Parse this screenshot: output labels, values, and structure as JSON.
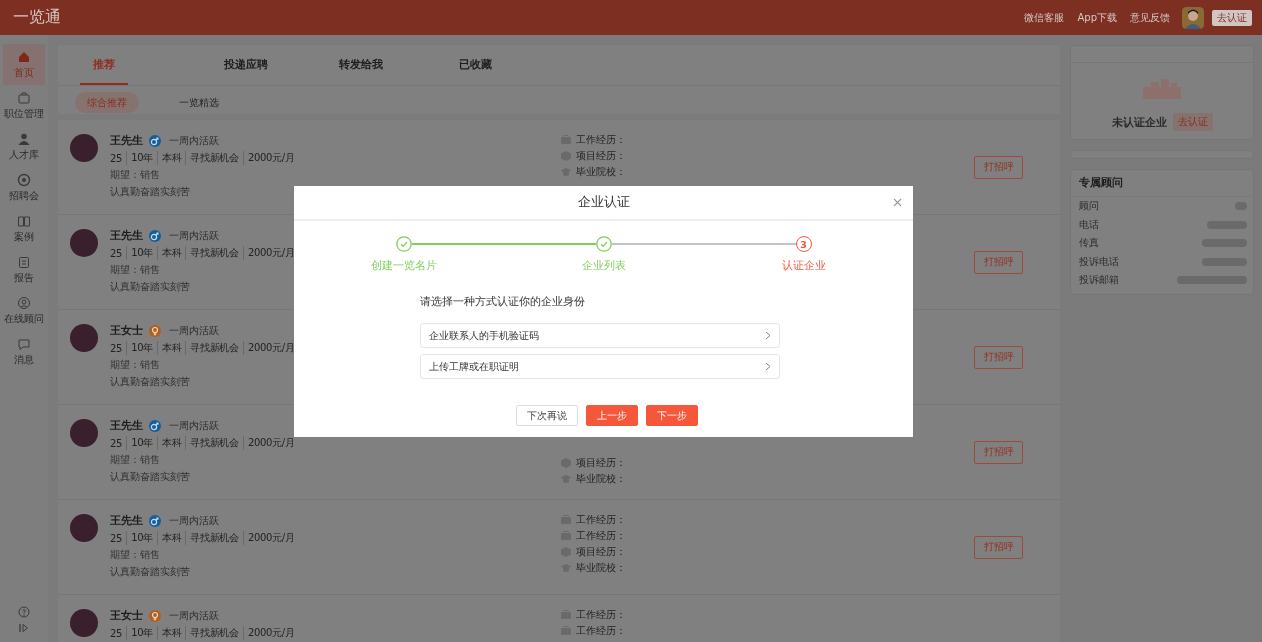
{
  "topbar": {
    "logo": "一览通",
    "links": [
      "微信客服",
      "App下载",
      "意见反馈"
    ],
    "verify_button": "去认证"
  },
  "sidebar": {
    "items": [
      {
        "label": "首页",
        "selected": true
      },
      {
        "label": "职位管理",
        "selected": false
      },
      {
        "label": "人才库",
        "selected": false
      },
      {
        "label": "招聘会",
        "selected": false
      },
      {
        "label": "案例",
        "selected": false
      },
      {
        "label": "报告",
        "selected": false
      },
      {
        "label": "在线顾问",
        "selected": false
      },
      {
        "label": "消息",
        "selected": false
      }
    ]
  },
  "tabs": [
    {
      "label": "推荐",
      "selected": true
    },
    {
      "label": "投递应聘",
      "selected": false
    },
    {
      "label": "转发给我",
      "selected": false
    },
    {
      "label": "已收藏",
      "selected": false
    }
  ],
  "subtabs": [
    {
      "label": "综合推荐",
      "selected": true
    },
    {
      "label": "一览精选",
      "selected": false
    }
  ],
  "candidates": [
    {
      "name": "王先生",
      "kind": "male",
      "activity": "一周内活跃",
      "stats": [
        "25",
        "10年",
        "本科",
        "寻找新机会",
        "2000元/月"
      ],
      "expect": "期望：销售",
      "motto": "认真勤奋踏实刻苦",
      "experience": [
        {
          "kind": "work",
          "label": "工作经历："
        },
        {
          "kind": "project",
          "label": "项目经历："
        },
        {
          "kind": "school",
          "label": "毕业院校："
        }
      ],
      "action": "打招呼"
    },
    {
      "name": "王先生",
      "kind": "male",
      "activity": "一周内活跃",
      "stats": [
        "25",
        "10年",
        "本科",
        "寻找新机会",
        "2000元/月"
      ],
      "expect": "期望：销售",
      "motto": "认真勤奋踏实刻苦",
      "action": "打招呼"
    },
    {
      "name": "王女士",
      "kind": "female",
      "activity": "一周内活跃",
      "stats": [
        "25",
        "10年",
        "本科",
        "寻找新机会",
        "2000元/月"
      ],
      "expect": "期望：销售",
      "motto": "认真勤奋踏实刻苦",
      "action": "打招呼"
    },
    {
      "name": "王先生",
      "kind": "male",
      "activity": "一周内活跃",
      "stats": [
        "25",
        "10年",
        "本科",
        "寻找新机会",
        "2000元/月"
      ],
      "expect": "期望：销售",
      "motto": "认真勤奋踏实刻苦",
      "experience": [
        {
          "kind": "project",
          "label": "项目经历："
        },
        {
          "kind": "school",
          "label": "毕业院校："
        }
      ],
      "action": "打招呼"
    },
    {
      "name": "王先生",
      "kind": "male",
      "activity": "一周内活跃",
      "stats": [
        "25",
        "10年",
        "本科",
        "寻找新机会",
        "2000元/月"
      ],
      "expect": "期望：销售",
      "motto": "认真勤奋踏实刻苦",
      "experience": [
        {
          "kind": "work",
          "label": "工作经历："
        },
        {
          "kind": "work",
          "label": "工作经历："
        },
        {
          "kind": "project",
          "label": "项目经历："
        },
        {
          "kind": "school",
          "label": "毕业院校："
        }
      ],
      "action": "打招呼"
    },
    {
      "name": "王女士",
      "kind": "female",
      "activity": "一周内活跃",
      "stats": [
        "25",
        "10年",
        "本科",
        "寻找新机会",
        "2000元/月"
      ],
      "experience": [
        {
          "kind": "work",
          "label": "工作经历："
        },
        {
          "kind": "work",
          "label": "工作经历："
        }
      ]
    }
  ],
  "company_card": {
    "name": "未认证企业",
    "badge": "去认证"
  },
  "advisor_card": {
    "title": "专属顾问",
    "rows": [
      "顾问",
      "电话",
      "传真",
      "投诉电话",
      "投诉邮箱"
    ]
  },
  "modal": {
    "title": "企业认证",
    "steps": [
      {
        "label": "创建一览名片",
        "done": true
      },
      {
        "label": "企业列表",
        "done": true
      },
      {
        "label": "认证企业",
        "done": false,
        "number": "3"
      }
    ],
    "prompt": "请选择一种方式认证你的企业身份",
    "options": [
      "企业联系人的手机验证码",
      "上传工牌或在职证明"
    ],
    "buttons": [
      {
        "label": "下次再说",
        "kind": "plain"
      },
      {
        "label": "上一步",
        "kind": "primary"
      },
      {
        "label": "下一步",
        "kind": "primary"
      }
    ]
  }
}
